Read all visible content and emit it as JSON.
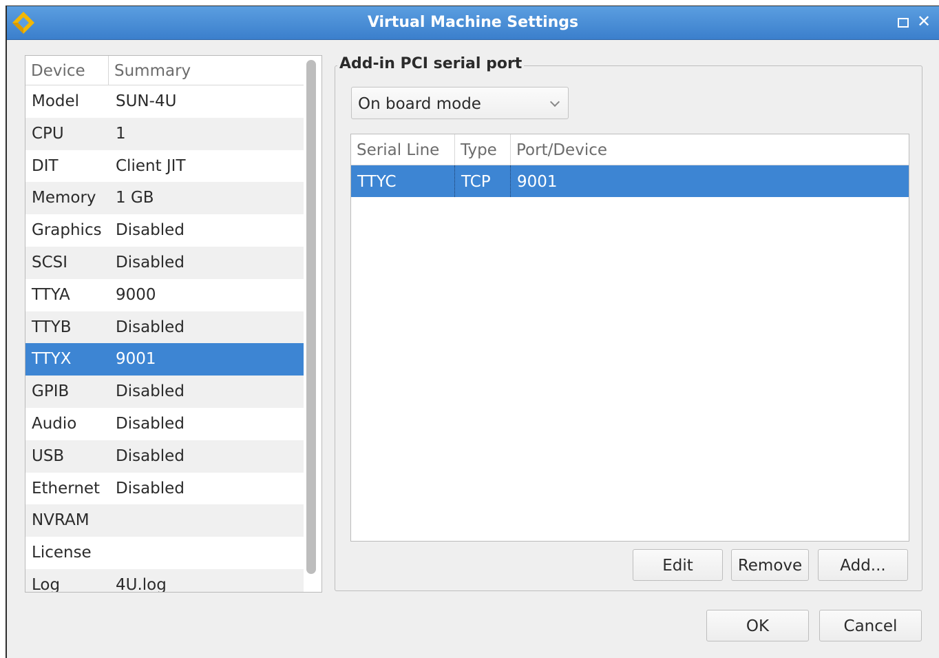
{
  "window": {
    "title": "Virtual Machine Settings",
    "titlebar_color": "#3b7fcc"
  },
  "device_list": {
    "columns": [
      "Device",
      "Summary"
    ],
    "rows": [
      {
        "device": "Model",
        "summary": "SUN-4U"
      },
      {
        "device": "CPU",
        "summary": "1"
      },
      {
        "device": "DIT",
        "summary": "Client JIT"
      },
      {
        "device": "Memory",
        "summary": "1 GB"
      },
      {
        "device": "Graphics",
        "summary": "Disabled"
      },
      {
        "device": "SCSI",
        "summary": "Disabled"
      },
      {
        "device": "TTYA",
        "summary": "9000"
      },
      {
        "device": "TTYB",
        "summary": "Disabled"
      },
      {
        "device": "TTYX",
        "summary": "9001"
      },
      {
        "device": "GPIB",
        "summary": "Disabled"
      },
      {
        "device": "Audio",
        "summary": "Disabled"
      },
      {
        "device": "USB",
        "summary": "Disabled"
      },
      {
        "device": "Ethernet",
        "summary": "Disabled"
      },
      {
        "device": "NVRAM",
        "summary": ""
      },
      {
        "device": "License",
        "summary": ""
      },
      {
        "device": "Log",
        "summary": "4U.log"
      }
    ],
    "selected_index": 8,
    "selection_color": "#3d85d3"
  },
  "serial_group": {
    "title": "Add-in PCI serial port",
    "mode_select": {
      "value": "On board mode"
    },
    "table": {
      "columns": [
        "Serial Line",
        "Type",
        "Port/Device"
      ],
      "rows": [
        {
          "line": "TTYC",
          "type": "TCP",
          "port": "9001"
        }
      ]
    },
    "buttons": {
      "edit": "Edit",
      "remove": "Remove",
      "add": "Add..."
    }
  },
  "dialog_buttons": {
    "ok": "OK",
    "cancel": "Cancel"
  }
}
